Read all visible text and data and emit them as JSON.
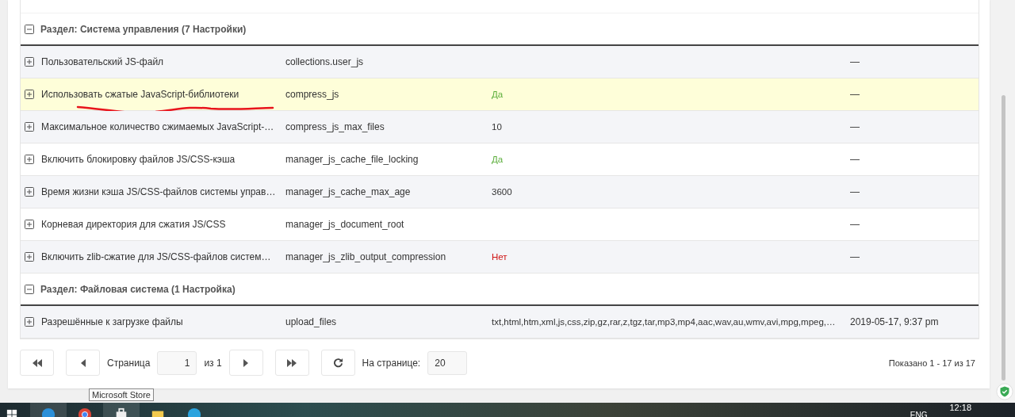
{
  "sections": [
    {
      "title": "Раздел: Система управления (7 Настройки)",
      "expanded": true,
      "rows": [
        {
          "name": "Пользовательский JS-файл",
          "key": "collections.user_js",
          "date": "—",
          "selected": false
        },
        {
          "name": "Использовать сжатые JavaScript-библиотеки",
          "key": "compress_js",
          "value": "Да",
          "kind": "yes",
          "date": "—",
          "selected": true
        },
        {
          "name": "Максимальное количество сжимаемых JavaScript-…",
          "key": "compress_js_max_files",
          "value": "10",
          "kind": "text",
          "date": "—",
          "selected": false
        },
        {
          "name": "Включить блокировку файлов JS/CSS-кэша",
          "key": "manager_js_cache_file_locking",
          "value": "Да",
          "kind": "yes",
          "date": "—",
          "selected": false
        },
        {
          "name": "Время жизни кэша JS/CSS-файлов системы управ…",
          "key": "manager_js_cache_max_age",
          "value": "3600",
          "kind": "text",
          "date": "—",
          "selected": false
        },
        {
          "name": "Корневая директория для сжатия JS/CSS",
          "key": "manager_js_document_root",
          "date": "—",
          "selected": false
        },
        {
          "name": "Включить zlib-сжатие для JS/CSS-файлов систем…",
          "key": "manager_js_zlib_output_compression",
          "value": "Нет",
          "kind": "no",
          "date": "—",
          "selected": false
        }
      ]
    },
    {
      "title": "Раздел: Файловая система (1 Настройка)",
      "expanded": true,
      "rows": [
        {
          "name": "Разрешённые к загрузке файлы",
          "key": "upload_files",
          "value": "txt,html,htm,xml,js,css,zip,gz,rar,z,tgz,tar,mp3,mp4,aac,wav,au,wmv,avi,mpg,mpeg,…",
          "kind": "text",
          "date": "2019-05-17, 9:37 pm",
          "selected": false
        }
      ]
    }
  ],
  "annotation": {
    "kind": "underline"
  },
  "pager": {
    "page_label": "Страница",
    "page": "1",
    "of_label": "из 1",
    "per_page_label": "На странице:",
    "per_page": "20",
    "summary": "Показано 1 - 17 из 17"
  },
  "tooltip": "Microsoft Store",
  "taskbar": {
    "language": "ENG",
    "clock": "12:18"
  }
}
